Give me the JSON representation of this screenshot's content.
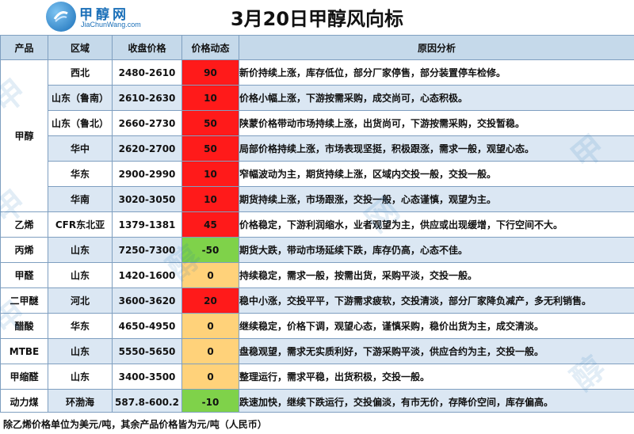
{
  "header": {
    "logo_cn": "甲醇网",
    "logo_en": "JiaChunWang.com",
    "title": "3月20日甲醇风向标"
  },
  "columns": [
    "产品",
    "区域",
    "收盘价格",
    "价格动态",
    "原因分析"
  ],
  "groups": {
    "methanol": "甲醇"
  },
  "rows": [
    {
      "product": "",
      "region": "西北",
      "price": "2480-2610",
      "change": "90",
      "trend": "up",
      "reason": "新价持续上涨，库存低位，部分厂家停售，部分装置停车检修。"
    },
    {
      "product": "",
      "region": "山东（鲁南）",
      "price": "2610-2630",
      "change": "10",
      "trend": "up",
      "reason": "价格小幅上涨，下游按需采购，成交尚可，心态积极。"
    },
    {
      "product": "",
      "region": "山东（鲁北）",
      "price": "2660-2730",
      "change": "50",
      "trend": "up",
      "reason": "陕蒙价格带动市场持续上涨，出货尚可，下游按需采购，交投暂稳。"
    },
    {
      "product": "",
      "region": "华中",
      "price": "2620-2700",
      "change": "50",
      "trend": "up",
      "reason": "局部价格持续上涨，市场表现坚挺，积极跟涨，需求一般，观望心态。"
    },
    {
      "product": "",
      "region": "华东",
      "price": "2900-2990",
      "change": "10",
      "trend": "up",
      "reason": "窄幅波动为主，期货持续上涨，区域内交投一般，交投一般。"
    },
    {
      "product": "",
      "region": "华南",
      "price": "3020-3050",
      "change": "10",
      "trend": "up",
      "reason": "期货持续上涨，市场跟涨，交投一般，心态谨慎，观望为主。"
    },
    {
      "product": "乙烯",
      "region": "CFR东北亚",
      "price": "1379-1381",
      "change": "45",
      "trend": "up",
      "reason": "价格稳定，下游利润缩水，业者观望为主，供应或出现缓增，下行空间不大。"
    },
    {
      "product": "丙烯",
      "region": "山东",
      "price": "7250-7300",
      "change": "-50",
      "trend": "down",
      "reason": "期货大跌，带动市场延续下跌，库存仍高，心态不佳。"
    },
    {
      "product": "甲醛",
      "region": "山东",
      "price": "1420-1600",
      "change": "0",
      "trend": "flat",
      "reason": "持续稳定，需求一般，按需出货，采购平淡，交投一般。"
    },
    {
      "product": "二甲醚",
      "region": "河北",
      "price": "3600-3620",
      "change": "20",
      "trend": "up",
      "reason": "稳中小涨，交投平平，下游需求疲软，交投清淡，部分厂家降负减产，多无利销售。"
    },
    {
      "product": "醋酸",
      "region": "华东",
      "price": "4650-4950",
      "change": "0",
      "trend": "flat",
      "reason": "继续稳定，价格下调，观望心态，谨慎采购，稳价出货为主，成交清淡。"
    },
    {
      "product": "MTBE",
      "region": "山东",
      "price": "5550-5650",
      "change": "0",
      "trend": "flat",
      "reason": "盘稳观望，需求无实质利好，下游采购平淡，供应合约为主，交投一般。"
    },
    {
      "product": "甲缩醛",
      "region": "山东",
      "price": "3400-3500",
      "change": "0",
      "trend": "flat",
      "reason": "整理运行，需求平稳，出货积极，交投一般。"
    },
    {
      "product": "动力煤",
      "region": "环渤海",
      "price": "587.8-600.2",
      "change": "-10",
      "trend": "down",
      "reason": "跌速加快，继续下跌运行，交投偏淡，有市无价，存降价空间，库存偏高。"
    }
  ],
  "footer": {
    "note": "除乙烯价格单位为美元/吨，其余产品价格皆为元/吨（人民币）"
  },
  "colors": {
    "up": "#ff1a1a",
    "down": "#7fd24a",
    "flat": "#ffd27a",
    "header_bg": "#c5d9ea",
    "stripe_bg": "#dbe7f3",
    "brand": "#1a6fb8"
  }
}
